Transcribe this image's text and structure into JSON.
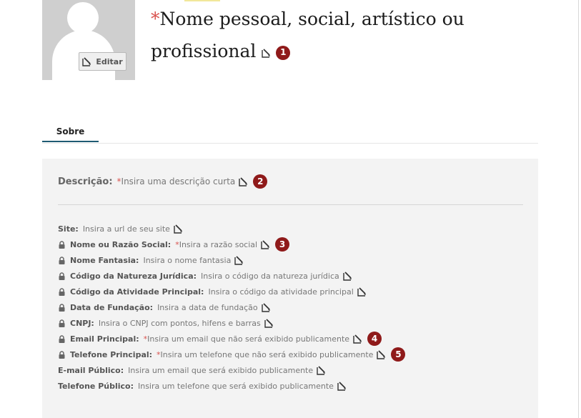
{
  "profile": {
    "edit_photo_label": "Editar",
    "title_required_mark": "*",
    "title": "Nome pessoal, social, artístico ou profissional",
    "title_badge": "1"
  },
  "tabs": [
    {
      "label": "Sobre",
      "active": true
    }
  ],
  "description": {
    "label": "Descrição:",
    "required_mark": "*",
    "placeholder": "Insira uma descrição curta",
    "badge": "2"
  },
  "fields": [
    {
      "label": "Site:",
      "locked": false,
      "required": false,
      "placeholder": "Insira a url de seu site"
    },
    {
      "label": "Nome ou Razão Social:",
      "locked": true,
      "required": true,
      "placeholder": "Insira a razão social",
      "badge": "3"
    },
    {
      "label": "Nome Fantasia:",
      "locked": true,
      "required": false,
      "placeholder": "Insira o nome fantasia"
    },
    {
      "label": "Código da Natureza Jurídica:",
      "locked": true,
      "required": false,
      "placeholder": "Insira o código da natureza jurídica"
    },
    {
      "label": "Código da Atividade Principal:",
      "locked": true,
      "required": false,
      "placeholder": "Insira o código da atividade principal"
    },
    {
      "label": "Data de Fundação:",
      "locked": true,
      "required": false,
      "placeholder": "Insira a data de fundação"
    },
    {
      "label": "CNPJ:",
      "locked": true,
      "required": false,
      "placeholder": "Insira o CNPJ com pontos, hifens e barras"
    },
    {
      "label": "Email Principal:",
      "locked": true,
      "required": true,
      "placeholder": "Insira um email que não será exibido publicamente",
      "badge": "4"
    },
    {
      "label": "Telefone Principal:",
      "locked": true,
      "required": true,
      "placeholder": "Insira um telefone que não será exibido publicamente",
      "badge": "5"
    },
    {
      "label": "E-mail Público:",
      "locked": false,
      "required": false,
      "placeholder": "Insira um email que será exibido publicamente"
    },
    {
      "label": "Telefone Público:",
      "locked": false,
      "required": false,
      "placeholder": "Insira um telefone que será exibido publicamente"
    }
  ],
  "colors": {
    "required": "#d9534f",
    "badge": "#8f1a1a",
    "tab_underline": "#1e5a72",
    "panel_bg": "#f3f3f3"
  },
  "icons": {
    "edit": "edit-pencil-icon",
    "lock": "lock-icon",
    "avatar": "user-silhouette-icon"
  }
}
